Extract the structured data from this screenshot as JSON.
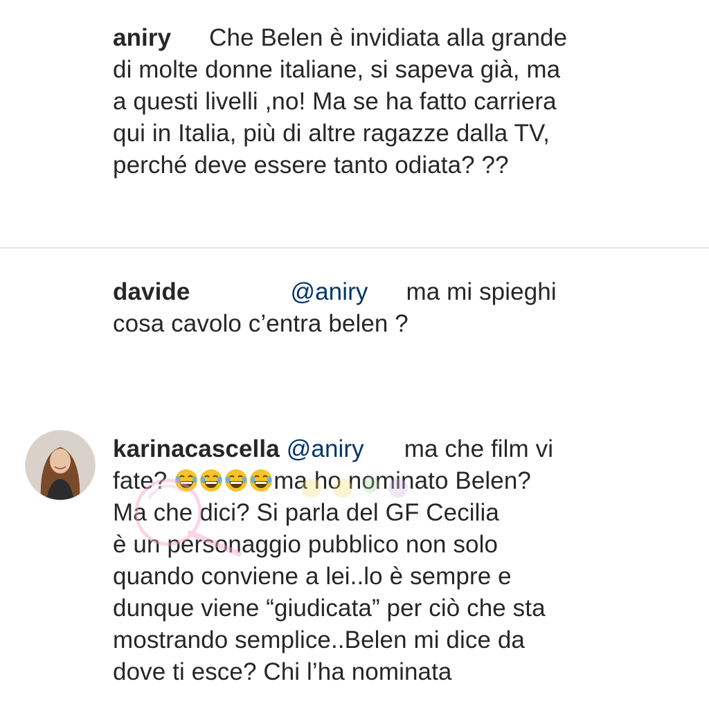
{
  "comments": [
    {
      "username": "aniry",
      "lines": [
        "Che Belen è invidiata alla grande",
        "di molte donne italiane, si sapeva già, ma",
        "a questi livelli ,no! Ma se ha fatto carriera",
        "qui in Italia, più di altre ragazze dalla TV,",
        "perché deve essere tanto odiata? ??"
      ]
    },
    {
      "username": "davide",
      "mention": "@aniry",
      "lines": [
        "ma mi spieghi",
        "cosa cavolo c’entra belen ?"
      ]
    },
    {
      "username": "karinacascella",
      "mention": "@aniry",
      "lines": [
        "ma che film vi",
        "fate?",
        "ma ho nominato Belen?",
        "Ma che dici? Si parla del GF Cecilia",
        "è un personaggio pubblico non solo",
        "quando conviene a lei..lo è sempre e",
        "dunque viene “giudicata” per ciò che sta",
        "mostrando semplice..Belen mi dice da",
        "dove ti esce? Chi l’ha nominata"
      ],
      "emoji": [
        "face-with-tears-of-joy-icon",
        "face-with-tears-of-joy-icon",
        "face-with-tears-of-joy-icon",
        "face-with-tears-of-joy-icon"
      ]
    }
  ],
  "colors": {
    "text": "#262626",
    "mention": "#003569",
    "divider": "#e6e6e6",
    "emoji_face": "#f7c325"
  }
}
